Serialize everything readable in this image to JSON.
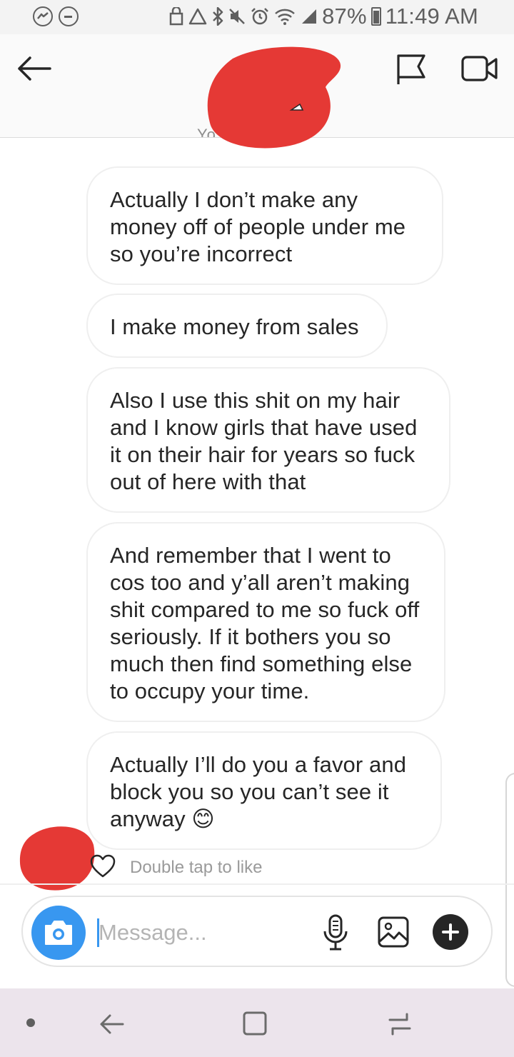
{
  "status_bar": {
    "battery": "87%",
    "time": "11:49 AM",
    "left_icons": [
      "messenger-icon",
      "do-not-disturb-icon"
    ],
    "right_icons": [
      "secure-folder-icon",
      "recycle-icon",
      "bluetooth-icon",
      "mute-icon",
      "alarm-icon",
      "wifi-icon",
      "signal-icon",
      "battery-icon"
    ]
  },
  "header": {
    "partial_text": "Yo"
  },
  "messages": [
    {
      "text": "Actually I don’t make any money off of people under me so you’re incorrect"
    },
    {
      "text": "I make money from sales"
    },
    {
      "text": "Also I use this shit on my hair and I know girls that have used it on their hair for years so fuck out of here with that"
    },
    {
      "text": "And remember that I went to cos too and y’all aren’t making shit compared to me so fuck off seriously. If it bothers you so much then find something else to occupy your time."
    },
    {
      "text": "Actually I’ll do you a favor and block you so you can’t see it anyway 😊"
    }
  ],
  "double_tap_label": "Double tap to like",
  "composer": {
    "placeholder": "Message...",
    "value": ""
  },
  "colors": {
    "accent": "#3897f0",
    "redaction": "#e53935",
    "text": "#262626",
    "nav_bar": "#ece4ec"
  }
}
